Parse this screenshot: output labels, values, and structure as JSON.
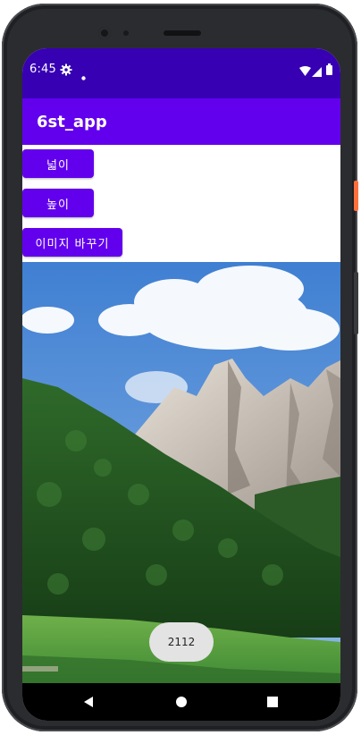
{
  "status_bar": {
    "time": "6:45",
    "icons": [
      "gear-icon",
      "notification-dot-icon",
      "wifi-icon",
      "cellular-signal-icon",
      "battery-icon"
    ]
  },
  "app_bar": {
    "title": "6st_app"
  },
  "buttons": {
    "width_label": "넓이",
    "height_label": "높이",
    "change_image_label": "이미지 바꾸기"
  },
  "image": {
    "description_icon": "mountain-landscape-image"
  },
  "toast": {
    "text": "2112"
  },
  "nav_bar": {
    "icons": [
      "back-icon",
      "home-icon",
      "recents-icon"
    ]
  },
  "colors": {
    "status_bar": "#3700b3",
    "app_bar": "#6200ee",
    "button": "#6200ee",
    "toast_bg": "#e3e3e3",
    "nav_bar": "#000000"
  }
}
